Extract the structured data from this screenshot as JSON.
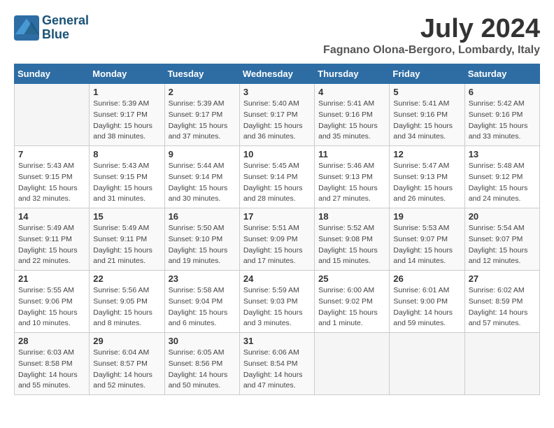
{
  "header": {
    "logo_line1": "General",
    "logo_line2": "Blue",
    "month_year": "July 2024",
    "location": "Fagnano Olona-Bergoro, Lombardy, Italy"
  },
  "weekdays": [
    "Sunday",
    "Monday",
    "Tuesday",
    "Wednesday",
    "Thursday",
    "Friday",
    "Saturday"
  ],
  "weeks": [
    [
      {
        "day": "",
        "sunrise": "",
        "sunset": "",
        "daylight": ""
      },
      {
        "day": "1",
        "sunrise": "Sunrise: 5:39 AM",
        "sunset": "Sunset: 9:17 PM",
        "daylight": "Daylight: 15 hours and 38 minutes."
      },
      {
        "day": "2",
        "sunrise": "Sunrise: 5:39 AM",
        "sunset": "Sunset: 9:17 PM",
        "daylight": "Daylight: 15 hours and 37 minutes."
      },
      {
        "day": "3",
        "sunrise": "Sunrise: 5:40 AM",
        "sunset": "Sunset: 9:17 PM",
        "daylight": "Daylight: 15 hours and 36 minutes."
      },
      {
        "day": "4",
        "sunrise": "Sunrise: 5:41 AM",
        "sunset": "Sunset: 9:16 PM",
        "daylight": "Daylight: 15 hours and 35 minutes."
      },
      {
        "day": "5",
        "sunrise": "Sunrise: 5:41 AM",
        "sunset": "Sunset: 9:16 PM",
        "daylight": "Daylight: 15 hours and 34 minutes."
      },
      {
        "day": "6",
        "sunrise": "Sunrise: 5:42 AM",
        "sunset": "Sunset: 9:16 PM",
        "daylight": "Daylight: 15 hours and 33 minutes."
      }
    ],
    [
      {
        "day": "7",
        "sunrise": "Sunrise: 5:43 AM",
        "sunset": "Sunset: 9:15 PM",
        "daylight": "Daylight: 15 hours and 32 minutes."
      },
      {
        "day": "8",
        "sunrise": "Sunrise: 5:43 AM",
        "sunset": "Sunset: 9:15 PM",
        "daylight": "Daylight: 15 hours and 31 minutes."
      },
      {
        "day": "9",
        "sunrise": "Sunrise: 5:44 AM",
        "sunset": "Sunset: 9:14 PM",
        "daylight": "Daylight: 15 hours and 30 minutes."
      },
      {
        "day": "10",
        "sunrise": "Sunrise: 5:45 AM",
        "sunset": "Sunset: 9:14 PM",
        "daylight": "Daylight: 15 hours and 28 minutes."
      },
      {
        "day": "11",
        "sunrise": "Sunrise: 5:46 AM",
        "sunset": "Sunset: 9:13 PM",
        "daylight": "Daylight: 15 hours and 27 minutes."
      },
      {
        "day": "12",
        "sunrise": "Sunrise: 5:47 AM",
        "sunset": "Sunset: 9:13 PM",
        "daylight": "Daylight: 15 hours and 26 minutes."
      },
      {
        "day": "13",
        "sunrise": "Sunrise: 5:48 AM",
        "sunset": "Sunset: 9:12 PM",
        "daylight": "Daylight: 15 hours and 24 minutes."
      }
    ],
    [
      {
        "day": "14",
        "sunrise": "Sunrise: 5:49 AM",
        "sunset": "Sunset: 9:11 PM",
        "daylight": "Daylight: 15 hours and 22 minutes."
      },
      {
        "day": "15",
        "sunrise": "Sunrise: 5:49 AM",
        "sunset": "Sunset: 9:11 PM",
        "daylight": "Daylight: 15 hours and 21 minutes."
      },
      {
        "day": "16",
        "sunrise": "Sunrise: 5:50 AM",
        "sunset": "Sunset: 9:10 PM",
        "daylight": "Daylight: 15 hours and 19 minutes."
      },
      {
        "day": "17",
        "sunrise": "Sunrise: 5:51 AM",
        "sunset": "Sunset: 9:09 PM",
        "daylight": "Daylight: 15 hours and 17 minutes."
      },
      {
        "day": "18",
        "sunrise": "Sunrise: 5:52 AM",
        "sunset": "Sunset: 9:08 PM",
        "daylight": "Daylight: 15 hours and 15 minutes."
      },
      {
        "day": "19",
        "sunrise": "Sunrise: 5:53 AM",
        "sunset": "Sunset: 9:07 PM",
        "daylight": "Daylight: 15 hours and 14 minutes."
      },
      {
        "day": "20",
        "sunrise": "Sunrise: 5:54 AM",
        "sunset": "Sunset: 9:07 PM",
        "daylight": "Daylight: 15 hours and 12 minutes."
      }
    ],
    [
      {
        "day": "21",
        "sunrise": "Sunrise: 5:55 AM",
        "sunset": "Sunset: 9:06 PM",
        "daylight": "Daylight: 15 hours and 10 minutes."
      },
      {
        "day": "22",
        "sunrise": "Sunrise: 5:56 AM",
        "sunset": "Sunset: 9:05 PM",
        "daylight": "Daylight: 15 hours and 8 minutes."
      },
      {
        "day": "23",
        "sunrise": "Sunrise: 5:58 AM",
        "sunset": "Sunset: 9:04 PM",
        "daylight": "Daylight: 15 hours and 6 minutes."
      },
      {
        "day": "24",
        "sunrise": "Sunrise: 5:59 AM",
        "sunset": "Sunset: 9:03 PM",
        "daylight": "Daylight: 15 hours and 3 minutes."
      },
      {
        "day": "25",
        "sunrise": "Sunrise: 6:00 AM",
        "sunset": "Sunset: 9:02 PM",
        "daylight": "Daylight: 15 hours and 1 minute."
      },
      {
        "day": "26",
        "sunrise": "Sunrise: 6:01 AM",
        "sunset": "Sunset: 9:00 PM",
        "daylight": "Daylight: 14 hours and 59 minutes."
      },
      {
        "day": "27",
        "sunrise": "Sunrise: 6:02 AM",
        "sunset": "Sunset: 8:59 PM",
        "daylight": "Daylight: 14 hours and 57 minutes."
      }
    ],
    [
      {
        "day": "28",
        "sunrise": "Sunrise: 6:03 AM",
        "sunset": "Sunset: 8:58 PM",
        "daylight": "Daylight: 14 hours and 55 minutes."
      },
      {
        "day": "29",
        "sunrise": "Sunrise: 6:04 AM",
        "sunset": "Sunset: 8:57 PM",
        "daylight": "Daylight: 14 hours and 52 minutes."
      },
      {
        "day": "30",
        "sunrise": "Sunrise: 6:05 AM",
        "sunset": "Sunset: 8:56 PM",
        "daylight": "Daylight: 14 hours and 50 minutes."
      },
      {
        "day": "31",
        "sunrise": "Sunrise: 6:06 AM",
        "sunset": "Sunset: 8:54 PM",
        "daylight": "Daylight: 14 hours and 47 minutes."
      },
      {
        "day": "",
        "sunrise": "",
        "sunset": "",
        "daylight": ""
      },
      {
        "day": "",
        "sunrise": "",
        "sunset": "",
        "daylight": ""
      },
      {
        "day": "",
        "sunrise": "",
        "sunset": "",
        "daylight": ""
      }
    ]
  ]
}
